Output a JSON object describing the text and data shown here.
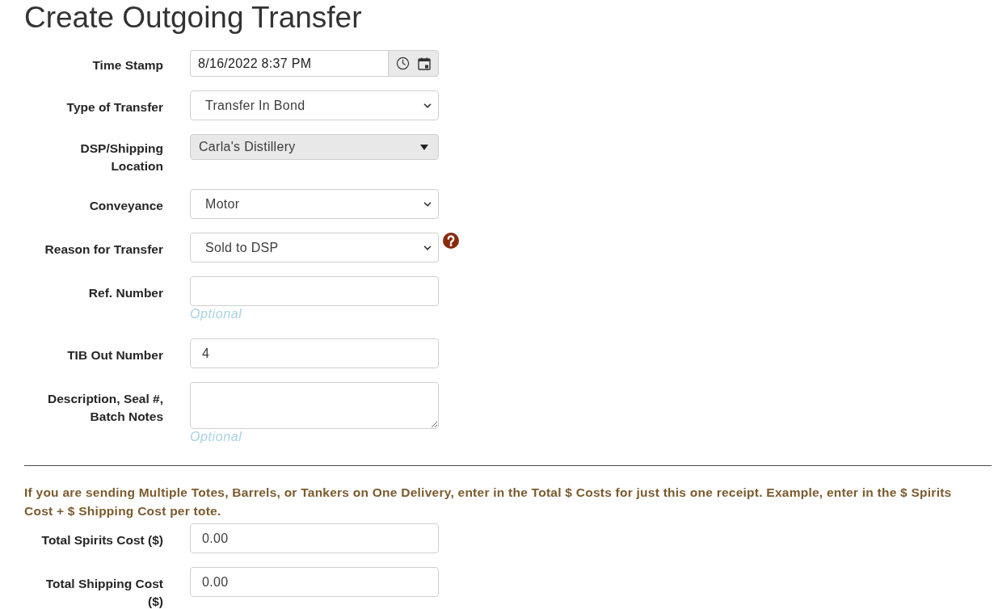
{
  "title": "Create Outgoing Transfer",
  "fields": [
    {
      "kind": "datetime",
      "label": "Time Stamp",
      "value": "8/16/2022 8:37 PM",
      "disabled": false,
      "help": false
    },
    {
      "kind": "select",
      "label": "Type of Transfer",
      "value": "Transfer In Bond",
      "disabled": false,
      "help": false
    },
    {
      "kind": "combo",
      "label": "DSP/Shipping Location",
      "value": "Carla's Distillery",
      "disabled": true,
      "help": false
    },
    {
      "kind": "select",
      "label": "Conveyance",
      "value": "Motor",
      "disabled": false,
      "help": false
    },
    {
      "kind": "select",
      "label": "Reason for Transfer",
      "value": "Sold to DSP",
      "disabled": false,
      "help": true
    },
    {
      "kind": "text",
      "label": "Ref. Number",
      "hint": "Optional",
      "disabled": false,
      "help": false
    },
    {
      "kind": "text",
      "label": "TIB Out Number",
      "value": "4",
      "disabled": false,
      "help": false
    },
    {
      "kind": "textarea",
      "label": "Description, Seal #, Batch Notes",
      "hint": "Optional",
      "disabled": false,
      "help": false
    }
  ],
  "cost_note": "If you are sending Multiple Totes, Barrels, or Tankers on One Delivery, enter in the Total $ Costs for just this one receipt. Example, enter in the $ Spirits Cost + $ Shipping Cost per tote.",
  "cost_fields": [
    {
      "kind": "text",
      "label": "Total Spirits Cost ($)",
      "value": "0.00",
      "disabled": false,
      "help": false
    },
    {
      "kind": "text",
      "label": "Total Shipping Cost ($)",
      "value": "0.00",
      "disabled": false,
      "help": false
    }
  ]
}
